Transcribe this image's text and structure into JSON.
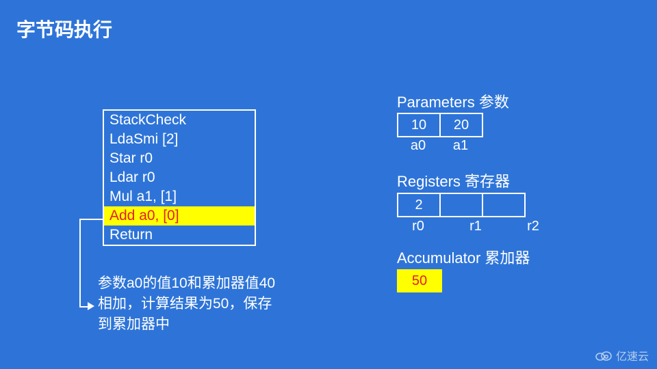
{
  "title": "字节码执行",
  "code": {
    "lines": [
      "StackCheck",
      "LdaSmi [2]",
      "Star r0",
      "Ldar r0",
      "Mul a1, [1]",
      "Add a0, [0]",
      "Return"
    ],
    "highlight_index": 5
  },
  "caption": "参数a0的值10和累加器值40相加，计算结果为50，保存到累加器中",
  "parameters": {
    "title": "Parameters 参数",
    "cells": [
      "10",
      "20"
    ],
    "labels": [
      "a0",
      "a1"
    ]
  },
  "registers": {
    "title": "Registers 寄存器",
    "cells": [
      "2",
      "",
      ""
    ],
    "labels": [
      "r0",
      "r1",
      "r2"
    ]
  },
  "accumulator": {
    "title": "Accumulator 累加器",
    "value": "50"
  },
  "watermark": "亿速云"
}
